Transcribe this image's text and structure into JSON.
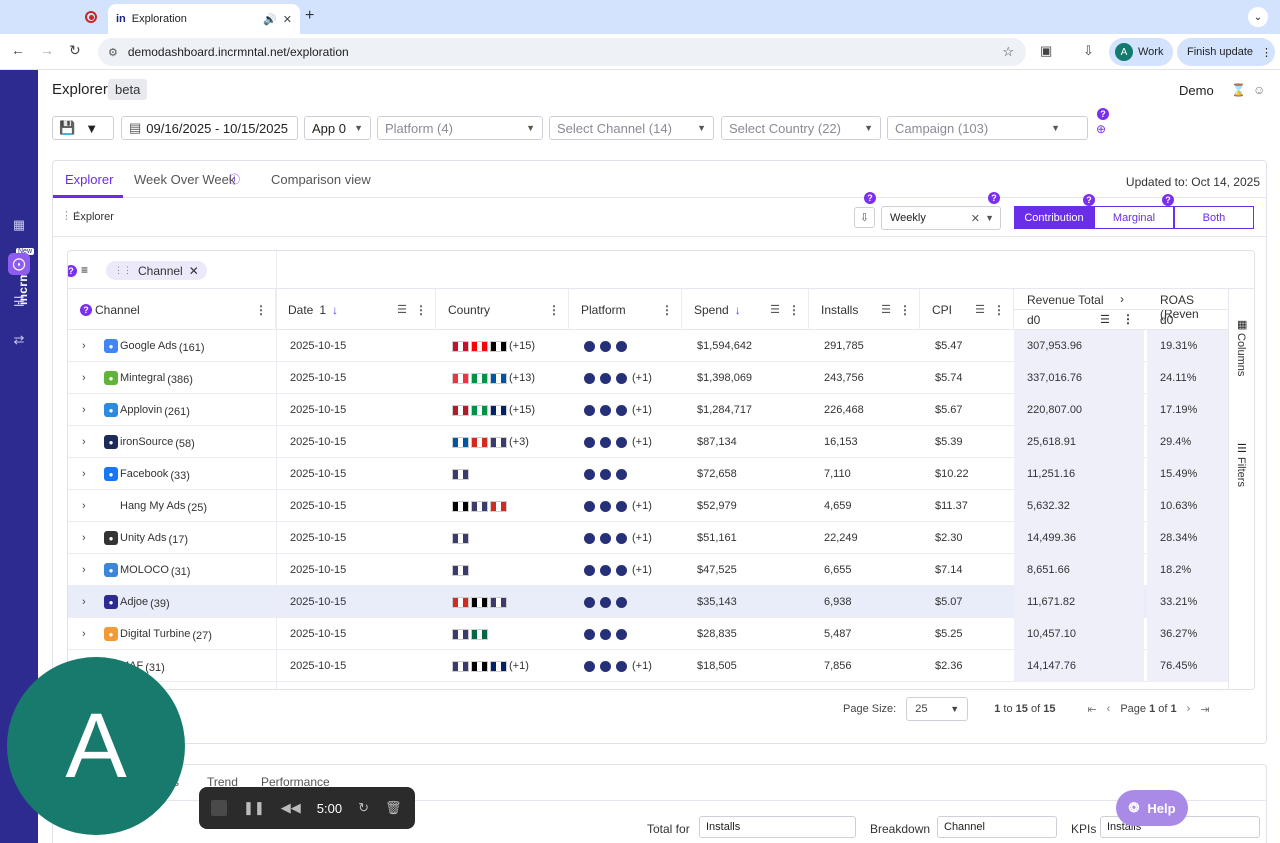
{
  "browser": {
    "tab_title": "Exploration",
    "tab_favicon": "in",
    "url": "demodashboard.incrmntal.net/exploration",
    "profile_initial": "A",
    "profile_label": "Work",
    "update_label": "Finish update"
  },
  "sidebar": {
    "logo": "incrmntal",
    "new_badge": "New",
    "icons": [
      "grid-icon",
      "explore-icon",
      "report-icon",
      "sync-icon"
    ]
  },
  "header": {
    "title": "Explorer",
    "badge": "beta",
    "user": "Demo"
  },
  "filters": {
    "date_range": "09/16/2025 - 10/15/2025",
    "app": "App 0",
    "platform": "Platform (4)",
    "channel": "Select Channel (14)",
    "country": "Select Country (22)",
    "campaign": "Campaign (103)"
  },
  "tabs": [
    "Explorer",
    "Week Over Week",
    "Comparison view"
  ],
  "updated": "Updated to: Oct 14, 2025",
  "toolbar": {
    "label": "Explorer",
    "granularity": "Weekly",
    "modes": [
      "Contribution",
      "Marginal",
      "Both"
    ]
  },
  "grid": {
    "group_chip": "Channel",
    "columns": {
      "channel": "Channel",
      "date": "Date",
      "date_sort": "1",
      "country": "Country",
      "platform": "Platform",
      "spend": "Spend",
      "installs": "Installs",
      "cpi": "CPI",
      "revenue": "Revenue Total",
      "revenue_sub": "d0",
      "roas": "ROAS (Reven",
      "roas_sub": "d0"
    },
    "side_labels": [
      "Columns",
      "Filters"
    ],
    "rows": [
      {
        "name": "Google Ads",
        "count": "(161)",
        "date": "2025-10-15",
        "flags": [
          "#c8102e",
          "#ff0000",
          "#000000"
        ],
        "country_extra": "(+15)",
        "platform_extra": "",
        "spend": "$1,594,642",
        "installs": "291,785",
        "cpi": "$5.47",
        "revenue": "307,953.96",
        "roas": "19.31%",
        "logo_color": "#4285f4"
      },
      {
        "name": "Mintegral",
        "count": "(386)",
        "date": "2025-10-15",
        "flags": [
          "#ef3340",
          "#009246",
          "#0055a4"
        ],
        "country_extra": "(+13)",
        "platform_extra": "(+1)",
        "spend": "$1,398,069",
        "installs": "243,756",
        "cpi": "$5.74",
        "revenue": "337,016.76",
        "roas": "24.11%",
        "logo_color": "#5fb53a"
      },
      {
        "name": "Applovin",
        "count": "(261)",
        "date": "2025-10-15",
        "flags": [
          "#ae1c28",
          "#009246",
          "#012169"
        ],
        "country_extra": "(+15)",
        "platform_extra": "(+1)",
        "spend": "$1,284,717",
        "installs": "226,468",
        "cpi": "$5.67",
        "revenue": "220,807.00",
        "roas": "17.19%",
        "logo_color": "#2a8be0"
      },
      {
        "name": "ironSource",
        "count": "(58)",
        "date": "2025-10-15",
        "flags": [
          "#0055a4",
          "#d52b1e",
          "#3c3b6e"
        ],
        "country_extra": "(+3)",
        "platform_extra": "(+1)",
        "spend": "$87,134",
        "installs": "16,153",
        "cpi": "$5.39",
        "revenue": "25,618.91",
        "roas": "29.4%",
        "logo_color": "#1d2b5a"
      },
      {
        "name": "Facebook",
        "count": "(33)",
        "date": "2025-10-15",
        "flags": [
          "#3c3b6e"
        ],
        "country_extra": "",
        "platform_extra": "",
        "spend": "$72,658",
        "installs": "7,110",
        "cpi": "$10.22",
        "revenue": "11,251.16",
        "roas": "15.49%",
        "logo_color": "#1877f2"
      },
      {
        "name": "Hang My Ads",
        "count": "(25)",
        "date": "2025-10-15",
        "flags": [
          "#000000",
          "#3c3b6e",
          "#d52b1e"
        ],
        "country_extra": "",
        "platform_extra": "(+1)",
        "spend": "$52,979",
        "installs": "4,659",
        "cpi": "$11.37",
        "revenue": "5,632.32",
        "roas": "10.63%",
        "logo_color": "#ffffff"
      },
      {
        "name": "Unity Ads",
        "count": "(17)",
        "date": "2025-10-15",
        "flags": [
          "#3c3b6e"
        ],
        "country_extra": "",
        "platform_extra": "(+1)",
        "spend": "$51,161",
        "installs": "22,249",
        "cpi": "$2.30",
        "revenue": "14,499.36",
        "roas": "28.34%",
        "logo_color": "#333333"
      },
      {
        "name": "MOLOCO",
        "count": "(31)",
        "date": "2025-10-15",
        "flags": [
          "#3c3b6e"
        ],
        "country_extra": "",
        "platform_extra": "(+1)",
        "spend": "$47,525",
        "installs": "6,655",
        "cpi": "$7.14",
        "revenue": "8,651.66",
        "roas": "18.2%",
        "logo_color": "#3a86d8"
      },
      {
        "name": "Adjoe",
        "count": "(39)",
        "date": "2025-10-15",
        "flags": [
          "#d52b1e",
          "#000000",
          "#3c3b6e"
        ],
        "country_extra": "",
        "platform_extra": "",
        "spend": "$35,143",
        "installs": "6,938",
        "cpi": "$5.07",
        "revenue": "11,671.82",
        "roas": "33.21%",
        "logo_color": "#2d2b8f"
      },
      {
        "name": "Digital Turbine",
        "count": "(27)",
        "date": "2025-10-15",
        "flags": [
          "#3c3b6e",
          "#006847"
        ],
        "country_extra": "",
        "platform_extra": "",
        "spend": "$28,835",
        "installs": "5,487",
        "cpi": "$5.25",
        "revenue": "10,457.10",
        "roas": "36.27%",
        "logo_color": "#f29a38"
      },
      {
        "name": "MAF",
        "count": "(31)",
        "date": "2025-10-15",
        "flags": [
          "#3c3b6e",
          "#000000",
          "#012169"
        ],
        "country_extra": "(+1)",
        "platform_extra": "(+1)",
        "spend": "$18,505",
        "installs": "7,856",
        "cpi": "$2.36",
        "revenue": "14,147.76",
        "roas": "76.45%",
        "logo_color": "#888888"
      }
    ]
  },
  "pager": {
    "page_size_label": "Page Size:",
    "page_size": "25",
    "range_start": "1",
    "range_to": "to",
    "range_end": "15",
    "range_of": "of",
    "total": "15",
    "page_label": "Page",
    "page": "1",
    "page_of": "of",
    "pages": "1"
  },
  "bottom": {
    "tabs": [
      "s",
      "Trend",
      "Performance"
    ],
    "total_for_label": "Total for",
    "total_for": "Installs",
    "breakdown_label": "Breakdown",
    "breakdown": "Channel",
    "kpis_label": "KPIs",
    "kpis": "Installs"
  },
  "overlay": {
    "avatar": "A",
    "timer": "5:00",
    "help": "Help"
  }
}
